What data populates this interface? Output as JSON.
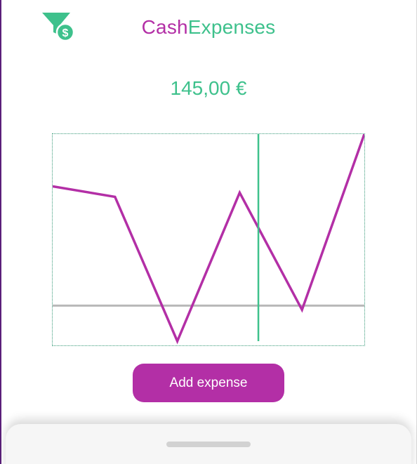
{
  "header": {
    "title_part1": "Cash",
    "title_part2": "Expenses",
    "logo_icon": "funnel-dollar-icon"
  },
  "total": {
    "amount": "145,00 €"
  },
  "actions": {
    "add_expense_label": "Add expense"
  },
  "colors": {
    "brand_purple": "#b32fa6",
    "brand_green": "#3ec18c",
    "baseline_gray": "#b8b8b8"
  },
  "chart_data": {
    "type": "line",
    "series": [
      {
        "values": [
          57,
          52,
          -17,
          54,
          -2,
          82
        ]
      }
    ],
    "baseline": 0,
    "ylim": [
      -17,
      82
    ],
    "cursor_position": 3.3,
    "grid": false,
    "legend": "none"
  }
}
